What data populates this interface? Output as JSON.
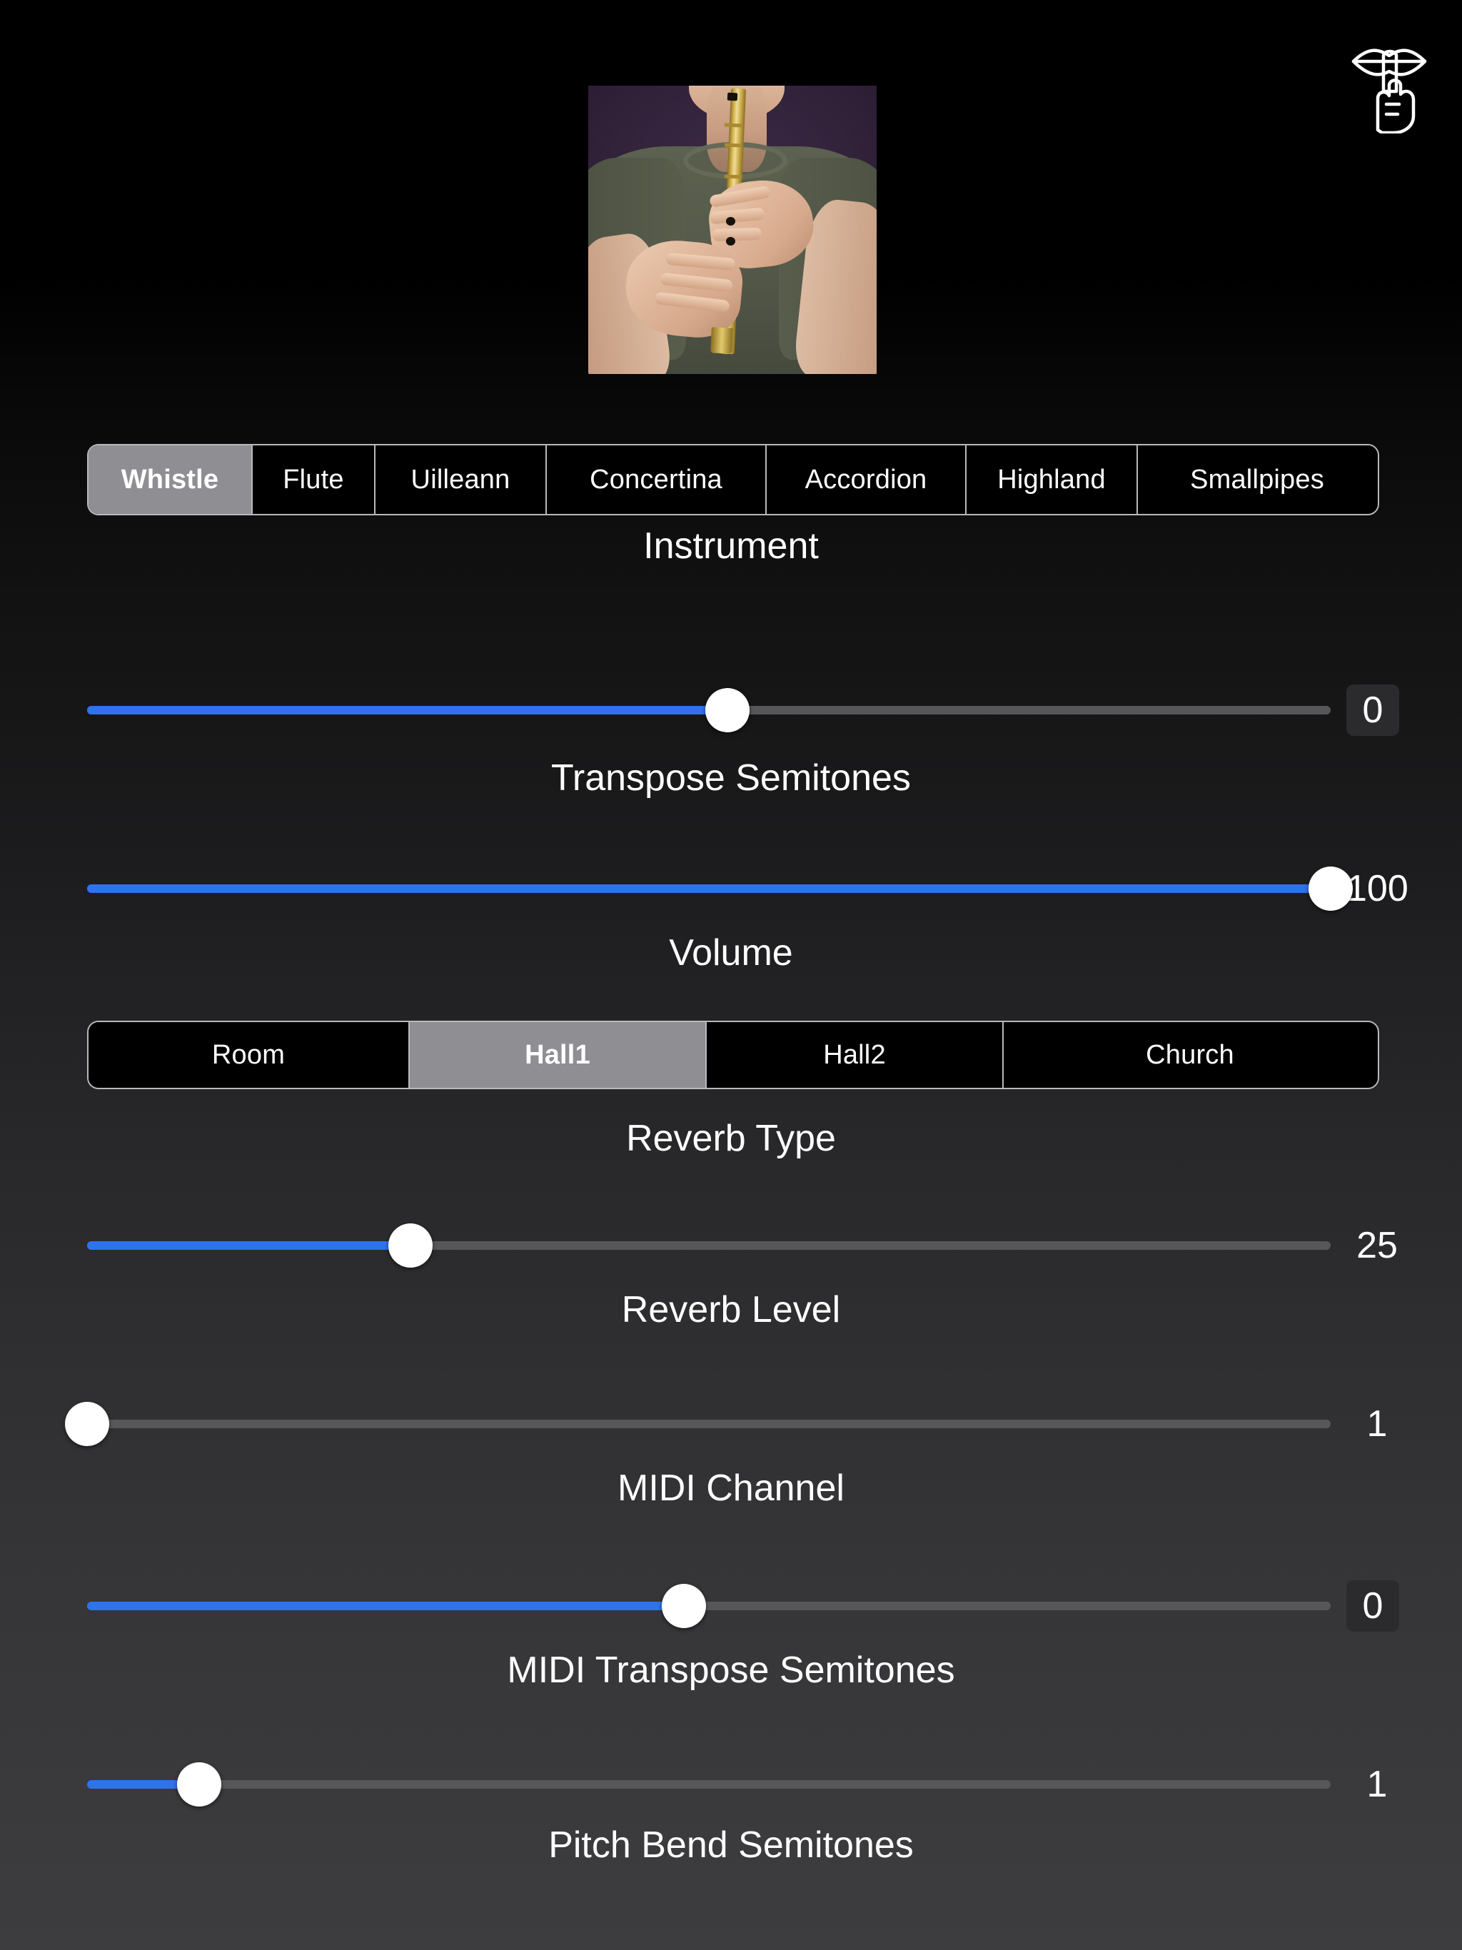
{
  "app": {
    "logo_icon": "shush-finger-to-lips-icon",
    "thumbnail_alt": "person playing tin whistle"
  },
  "instrument": {
    "label": "Instrument",
    "selected": "Whistle",
    "options": [
      "Whistle",
      "Flute",
      "Uilleann",
      "Concertina",
      "Accordion",
      "Highland",
      "Smallpipes"
    ]
  },
  "reverb_type": {
    "label": "Reverb Type",
    "selected": "Hall1",
    "options": [
      "Room",
      "Hall1",
      "Hall2",
      "Church"
    ]
  },
  "sliders": [
    {
      "name": "transpose-semitones",
      "label": "Transpose Semitones",
      "value": "0",
      "percent": 51.5,
      "boxed_value": true
    },
    {
      "name": "volume",
      "label": "Volume",
      "value": "100",
      "percent": 100,
      "boxed_value": false
    },
    {
      "name": "reverb-level",
      "label": "Reverb Level",
      "value": "25",
      "percent": 26,
      "boxed_value": false
    },
    {
      "name": "midi-channel",
      "label": "MIDI Channel",
      "value": "1",
      "percent": 0,
      "boxed_value": false
    },
    {
      "name": "midi-transpose-semitones",
      "label": "MIDI Transpose Semitones",
      "value": "0",
      "percent": 48,
      "boxed_value": true
    },
    {
      "name": "pitch-bend-semitones",
      "label": "Pitch Bend Semitones",
      "value": "1",
      "percent": 9,
      "boxed_value": false
    }
  ],
  "colors": {
    "accent_blue": "#2f72ee",
    "track_gray": "#57575a",
    "segment_selected": "#8e8e93",
    "value_box": "#2b2b2d"
  }
}
